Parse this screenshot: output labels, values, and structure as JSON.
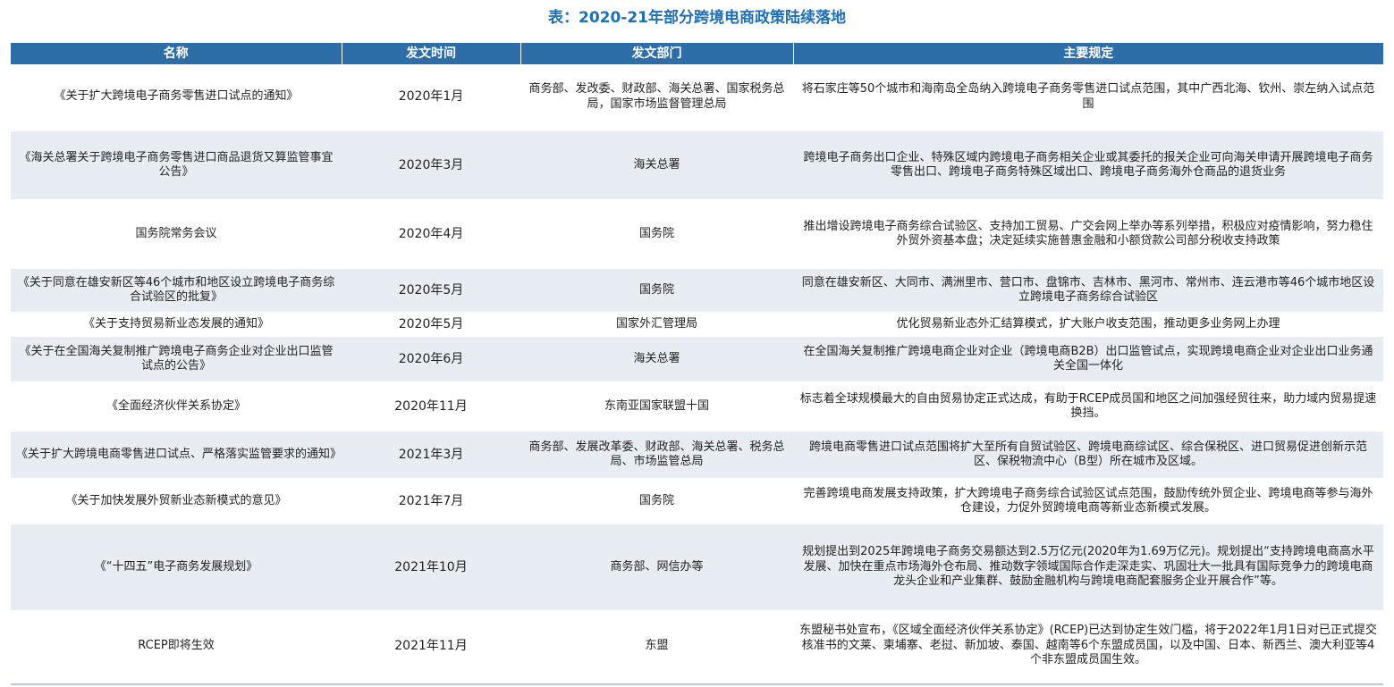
{
  "title": "表：2020-21年部分跨境电商政策陆续落地",
  "columns": {
    "name": "名称",
    "date": "发文时间",
    "dept": "发文部门",
    "rules": "主要规定"
  },
  "rows": [
    {
      "name": "《关于扩大跨境电子商务零售进口试点的通知》",
      "date": "2020年1月",
      "dept": "商务部、发改委、财政部、海关总署、国家税务总局，国家市场监督管理总局",
      "rules": "将石家庄等50个城市和海南岛全岛纳入跨境电子商务零售进口试点范围，其中广西北海、钦州、崇左纳入试点范围"
    },
    {
      "name": "《海关总署关于跨境电子商务零售进口商品退货又算监管事宜公告》",
      "date": "2020年3月",
      "dept": "海关总署",
      "rules": "跨境电子商务出口企业、特殊区域内跨境电子商务相关企业或其委托的报关企业可向海关申请开展跨境电子商务零售出口、跨境电子商务特殊区域出口、跨境电子商务海外仓商品的退货业务"
    },
    {
      "name": "国务院常务会议",
      "date": "2020年4月",
      "dept": "国务院",
      "rules": "推出增设跨境电子商务综合试验区、支持加工贸易、广交会网上举办等系列举措，积极应对疫情影响，努力稳住外贸外资基本盘；决定延续实施普惠金融和小额贷款公司部分税收支持政策"
    },
    {
      "name": "《关于同意在雄安新区等46个城市和地区设立跨境电子商务综合试验区的批复》",
      "date": "2020年5月",
      "dept": "国务院",
      "rules": "同意在雄安新区、大同市、满洲里市、营口市、盘锦市、吉林市、黑河市、常州市、连云港市等46个城市地区设立跨境电子商务综合试验区"
    },
    {
      "name": "《关于支持贸易新业态发展的通知》",
      "date": "2020年5月",
      "dept": "国家外汇管理局",
      "rules": "优化贸易新业态外汇结算模式，扩大账户收支范围，推动更多业务网上办理"
    },
    {
      "name": "《关于在全国海关复制推广跨境电子商务企业对企业出口监管试点的公告》",
      "date": "2020年6月",
      "dept": "海关总署",
      "rules": "在全国海关复制推广跨境电商企业对企业（跨境电商B2B）出口监管试点，实现跨境电商企业对企业出口业务通关全国一体化"
    },
    {
      "name": "《全面经济伙伴关系协定》",
      "date": "2020年11月",
      "dept": "东南亚国家联盟十国",
      "rules": "标志着全球规模最大的自由贸易协定正式达成，有助于RCEP成员国和地区之间加强经贸往来，助力域内贸易提速换挡。"
    },
    {
      "name": "《关于扩大跨境电商零售进口试点、严格落实监管要求的通知》",
      "date": "2021年3月",
      "dept": "商务部、发展改革委、财政部、海关总署、税务总局、市场监管总局",
      "rules": "跨境电商零售进口试点范围将扩大至所有自贸试验区、跨境电商综试区、综合保税区、进口贸易促进创新示范区、保税物流中心（B型）所在城市及区域。"
    },
    {
      "name": "《关于加快发展外贸新业态新模式的意见》",
      "date": "2021年7月",
      "dept": "国务院",
      "rules": "完善跨境电商发展支持政策，扩大跨境电子商务综合试验区试点范围，鼓励传统外贸企业、跨境电商等参与海外仓建设，力促外贸跨境电商等新业态新模式发展。"
    },
    {
      "name": "《“十四五”电子商务发展规划》",
      "date": "2021年10月",
      "dept": "商务部、网信办等",
      "rules": "规划提出到2025年跨境电子商务交易额达到2.5万亿元(2020年为1.69万亿元)。规划提出“支持跨境电商高水平发展、加快在重点市场海外仓布局、推动数字领域国际合作走深走实、巩固壮大一批具有国际竞争力的跨境电商龙头企业和产业集群、鼓励金融机构与跨境电商配套服务企业开展合作”等。"
    },
    {
      "name": "RCEP即将生效",
      "date": "2021年11月",
      "dept": "东盟",
      "rules": "东盟秘书处宣布，《区域全面经济伙伴关系协定》(RCEP)已达到协定生效门槛，将于2022年1月1日对已正式提交核准书的文莱、柬埔寨、老挝、新加坡、泰国、越南等6个东盟成员国，以及中国、日本、新西兰、澳大利亚等4个非东盟成员国生效。"
    }
  ]
}
